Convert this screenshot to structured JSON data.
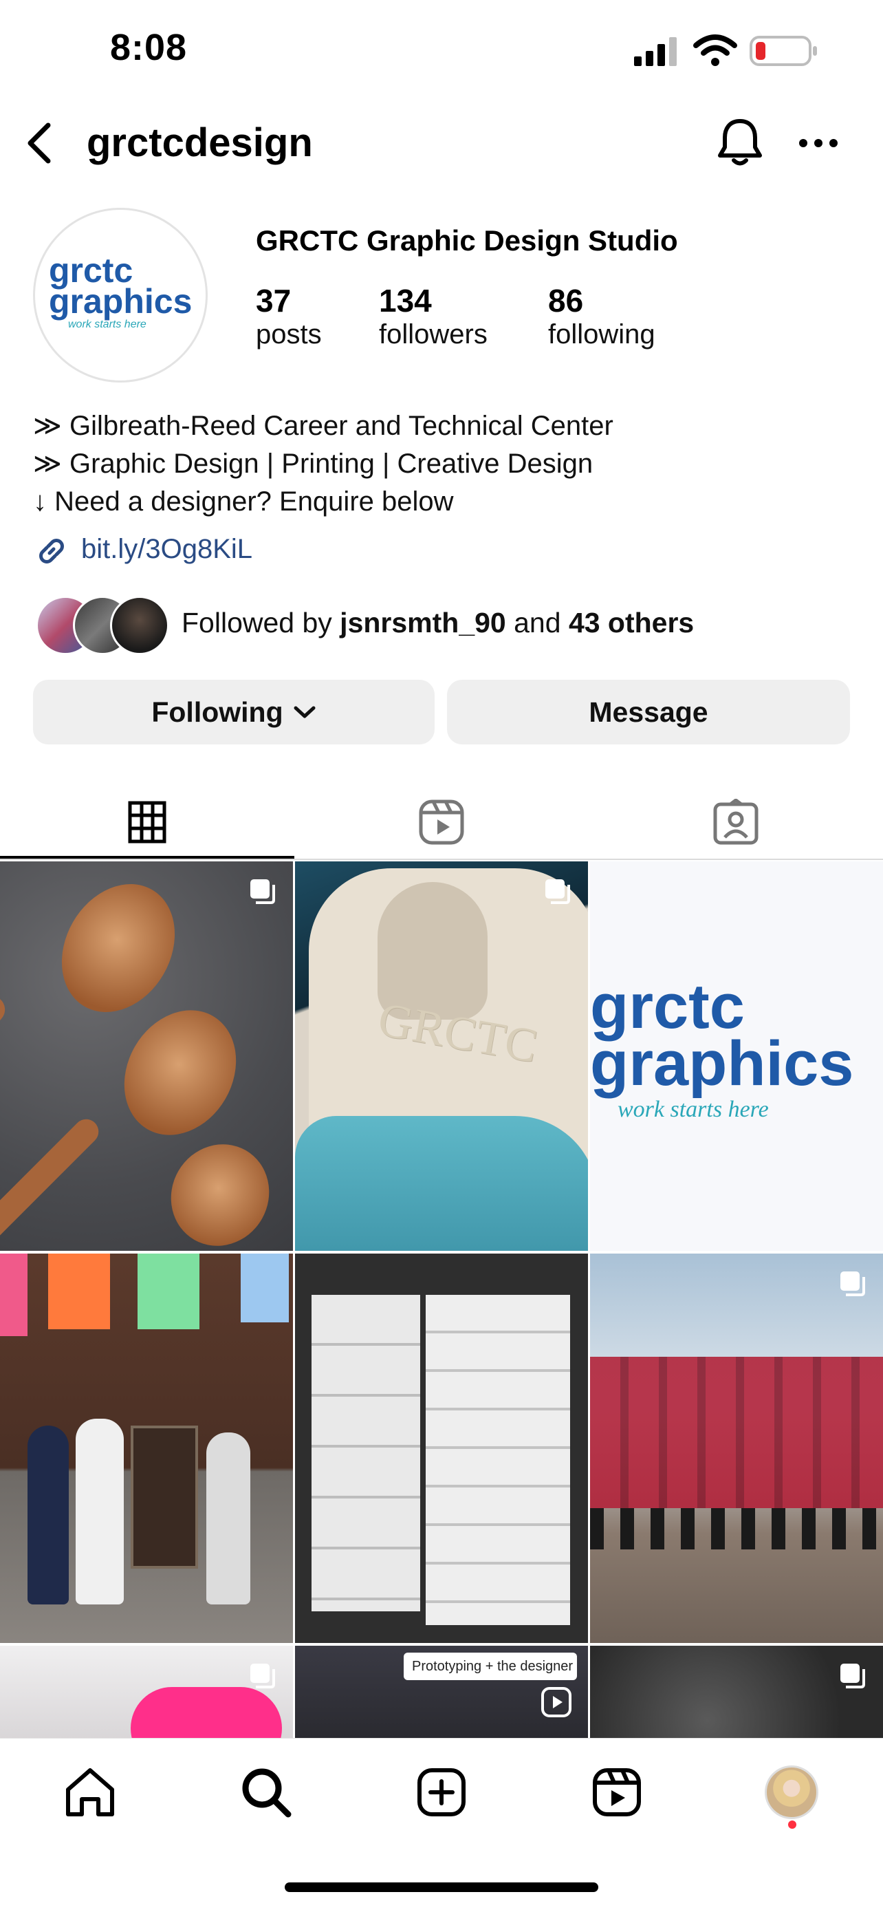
{
  "status": {
    "time": "8:08"
  },
  "header": {
    "username": "grctcdesign"
  },
  "profile": {
    "display_name": "GRCTC Graphic Design Studio",
    "avatar_logo": {
      "line1": "grctc",
      "line2": "graphics",
      "tagline": "work starts here"
    },
    "stats": [
      {
        "value": "37",
        "label": "posts"
      },
      {
        "value": "134",
        "label": "followers"
      },
      {
        "value": "86",
        "label": "following"
      }
    ],
    "bio": [
      "≫ Gilbreath-Reed Career and Technical Center",
      "≫ Graphic Design | Printing | Creative Design",
      "↓ Need a designer? Enquire below"
    ],
    "link": "bit.ly/3Og8KiL",
    "followed_by": {
      "prefix": "Followed by ",
      "user": "jsnrsmth_90",
      "middle": " and ",
      "others": "43 others"
    }
  },
  "buttons": {
    "following": "Following",
    "message": "Message"
  },
  "tabs": [
    {
      "name": "grid",
      "icon": "grid-icon"
    },
    {
      "name": "reels",
      "icon": "reels-icon"
    },
    {
      "name": "tagged",
      "icon": "tagged-icon"
    }
  ],
  "posts": {
    "logo_post": {
      "line1": "grctc",
      "line2": "graphics",
      "tagline": "work starts here"
    },
    "hoodie_text": "GRCTC",
    "reel_caption": "Prototyping + the designer"
  },
  "colors": {
    "brand_blue": "#1f5aa8",
    "brand_teal": "#2aa7b8",
    "battery_red": "#e5262b",
    "notification_dot": "#ff3040"
  },
  "bottom_nav": [
    "home-icon",
    "search-icon",
    "create-icon",
    "reels-icon",
    "profile-avatar"
  ]
}
